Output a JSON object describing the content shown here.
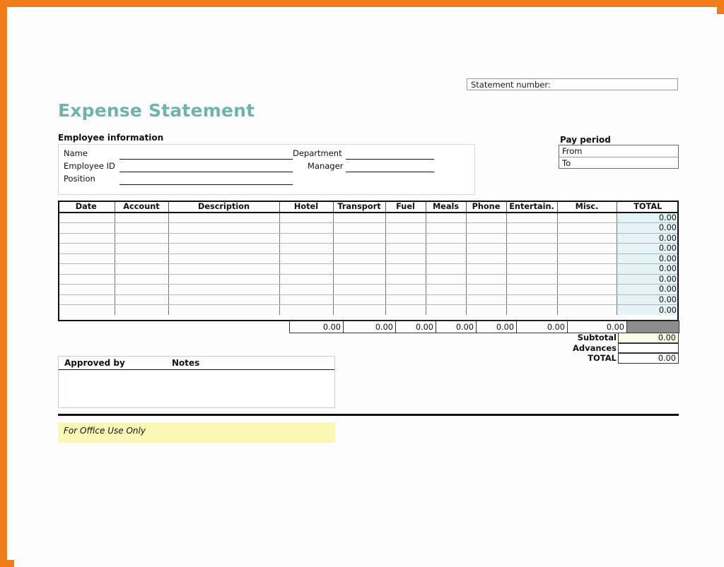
{
  "page": {
    "frame_color": "#f07c1a",
    "background": "#ffffff"
  },
  "statement": {
    "number_label": "Statement number:",
    "number_value": ""
  },
  "title": "Expense Statement",
  "employee": {
    "heading": "Employee information",
    "fields": [
      {
        "label": "Name",
        "value": ""
      },
      {
        "label": "Employee ID",
        "value": ""
      },
      {
        "label": "Position",
        "value": ""
      },
      {
        "label": "Department",
        "value": ""
      },
      {
        "label": "Manager",
        "value": ""
      }
    ]
  },
  "pay_period": {
    "heading": "Pay period",
    "from_label": "From",
    "from_value": "",
    "to_label": "To",
    "to_value": ""
  },
  "expense_table": {
    "columns": [
      "Date",
      "Account",
      "Description",
      "Hotel",
      "Transport",
      "Fuel",
      "Meals",
      "Phone",
      "Entertain.",
      "Misc.",
      "TOTAL"
    ],
    "row_total_values": [
      "0.00",
      "0.00",
      "0.00",
      "0.00",
      "0.00",
      "0.00",
      "0.00",
      "0.00",
      "0.00",
      "0.00"
    ],
    "column_totals": [
      "0.00",
      "0.00",
      "0.00",
      "0.00",
      "0.00",
      "0.00",
      "0.00"
    ],
    "total_cell_bg": "#e4f4f6",
    "greyed_cell_bg": "#8d8d8d"
  },
  "summary": {
    "subtotal_label": "Subtotal",
    "subtotal_value": "0.00",
    "advances_label": "Advances",
    "advances_value": "",
    "total_label": "TOTAL",
    "total_value": "0.00"
  },
  "approval": {
    "approved_by_label": "Approved by",
    "approved_by_value": "",
    "notes_label": "Notes",
    "notes_value": ""
  },
  "office_use": {
    "text": "For Office Use Only",
    "band_color": "#fbf7b5"
  }
}
